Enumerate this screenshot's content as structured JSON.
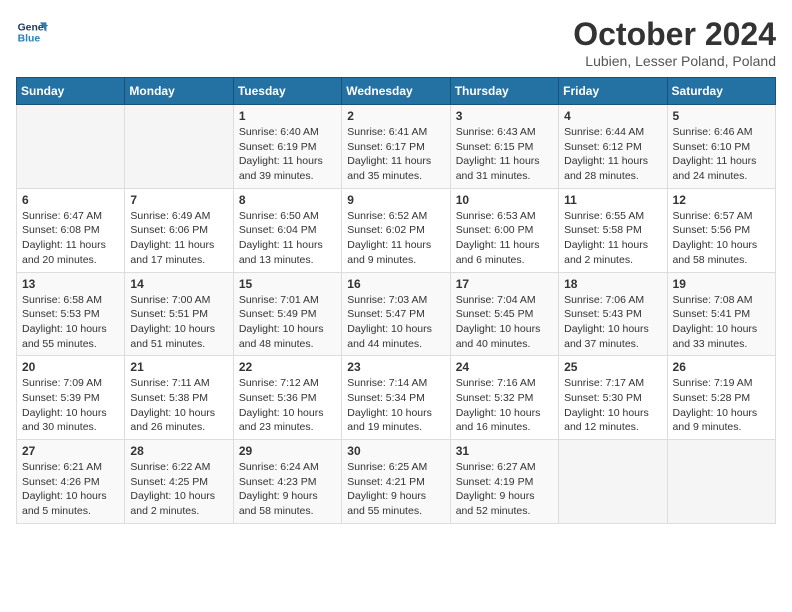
{
  "logo": {
    "line1": "General",
    "line2": "Blue"
  },
  "title": "October 2024",
  "subtitle": "Lubien, Lesser Poland, Poland",
  "headers": [
    "Sunday",
    "Monday",
    "Tuesday",
    "Wednesday",
    "Thursday",
    "Friday",
    "Saturday"
  ],
  "weeks": [
    [
      {
        "day": "",
        "info": ""
      },
      {
        "day": "",
        "info": ""
      },
      {
        "day": "1",
        "info": "Sunrise: 6:40 AM\nSunset: 6:19 PM\nDaylight: 11 hours\nand 39 minutes."
      },
      {
        "day": "2",
        "info": "Sunrise: 6:41 AM\nSunset: 6:17 PM\nDaylight: 11 hours\nand 35 minutes."
      },
      {
        "day": "3",
        "info": "Sunrise: 6:43 AM\nSunset: 6:15 PM\nDaylight: 11 hours\nand 31 minutes."
      },
      {
        "day": "4",
        "info": "Sunrise: 6:44 AM\nSunset: 6:12 PM\nDaylight: 11 hours\nand 28 minutes."
      },
      {
        "day": "5",
        "info": "Sunrise: 6:46 AM\nSunset: 6:10 PM\nDaylight: 11 hours\nand 24 minutes."
      }
    ],
    [
      {
        "day": "6",
        "info": "Sunrise: 6:47 AM\nSunset: 6:08 PM\nDaylight: 11 hours\nand 20 minutes."
      },
      {
        "day": "7",
        "info": "Sunrise: 6:49 AM\nSunset: 6:06 PM\nDaylight: 11 hours\nand 17 minutes."
      },
      {
        "day": "8",
        "info": "Sunrise: 6:50 AM\nSunset: 6:04 PM\nDaylight: 11 hours\nand 13 minutes."
      },
      {
        "day": "9",
        "info": "Sunrise: 6:52 AM\nSunset: 6:02 PM\nDaylight: 11 hours\nand 9 minutes."
      },
      {
        "day": "10",
        "info": "Sunrise: 6:53 AM\nSunset: 6:00 PM\nDaylight: 11 hours\nand 6 minutes."
      },
      {
        "day": "11",
        "info": "Sunrise: 6:55 AM\nSunset: 5:58 PM\nDaylight: 11 hours\nand 2 minutes."
      },
      {
        "day": "12",
        "info": "Sunrise: 6:57 AM\nSunset: 5:56 PM\nDaylight: 10 hours\nand 58 minutes."
      }
    ],
    [
      {
        "day": "13",
        "info": "Sunrise: 6:58 AM\nSunset: 5:53 PM\nDaylight: 10 hours\nand 55 minutes."
      },
      {
        "day": "14",
        "info": "Sunrise: 7:00 AM\nSunset: 5:51 PM\nDaylight: 10 hours\nand 51 minutes."
      },
      {
        "day": "15",
        "info": "Sunrise: 7:01 AM\nSunset: 5:49 PM\nDaylight: 10 hours\nand 48 minutes."
      },
      {
        "day": "16",
        "info": "Sunrise: 7:03 AM\nSunset: 5:47 PM\nDaylight: 10 hours\nand 44 minutes."
      },
      {
        "day": "17",
        "info": "Sunrise: 7:04 AM\nSunset: 5:45 PM\nDaylight: 10 hours\nand 40 minutes."
      },
      {
        "day": "18",
        "info": "Sunrise: 7:06 AM\nSunset: 5:43 PM\nDaylight: 10 hours\nand 37 minutes."
      },
      {
        "day": "19",
        "info": "Sunrise: 7:08 AM\nSunset: 5:41 PM\nDaylight: 10 hours\nand 33 minutes."
      }
    ],
    [
      {
        "day": "20",
        "info": "Sunrise: 7:09 AM\nSunset: 5:39 PM\nDaylight: 10 hours\nand 30 minutes."
      },
      {
        "day": "21",
        "info": "Sunrise: 7:11 AM\nSunset: 5:38 PM\nDaylight: 10 hours\nand 26 minutes."
      },
      {
        "day": "22",
        "info": "Sunrise: 7:12 AM\nSunset: 5:36 PM\nDaylight: 10 hours\nand 23 minutes."
      },
      {
        "day": "23",
        "info": "Sunrise: 7:14 AM\nSunset: 5:34 PM\nDaylight: 10 hours\nand 19 minutes."
      },
      {
        "day": "24",
        "info": "Sunrise: 7:16 AM\nSunset: 5:32 PM\nDaylight: 10 hours\nand 16 minutes."
      },
      {
        "day": "25",
        "info": "Sunrise: 7:17 AM\nSunset: 5:30 PM\nDaylight: 10 hours\nand 12 minutes."
      },
      {
        "day": "26",
        "info": "Sunrise: 7:19 AM\nSunset: 5:28 PM\nDaylight: 10 hours\nand 9 minutes."
      }
    ],
    [
      {
        "day": "27",
        "info": "Sunrise: 6:21 AM\nSunset: 4:26 PM\nDaylight: 10 hours\nand 5 minutes."
      },
      {
        "day": "28",
        "info": "Sunrise: 6:22 AM\nSunset: 4:25 PM\nDaylight: 10 hours\nand 2 minutes."
      },
      {
        "day": "29",
        "info": "Sunrise: 6:24 AM\nSunset: 4:23 PM\nDaylight: 9 hours\nand 58 minutes."
      },
      {
        "day": "30",
        "info": "Sunrise: 6:25 AM\nSunset: 4:21 PM\nDaylight: 9 hours\nand 55 minutes."
      },
      {
        "day": "31",
        "info": "Sunrise: 6:27 AM\nSunset: 4:19 PM\nDaylight: 9 hours\nand 52 minutes."
      },
      {
        "day": "",
        "info": ""
      },
      {
        "day": "",
        "info": ""
      }
    ]
  ]
}
